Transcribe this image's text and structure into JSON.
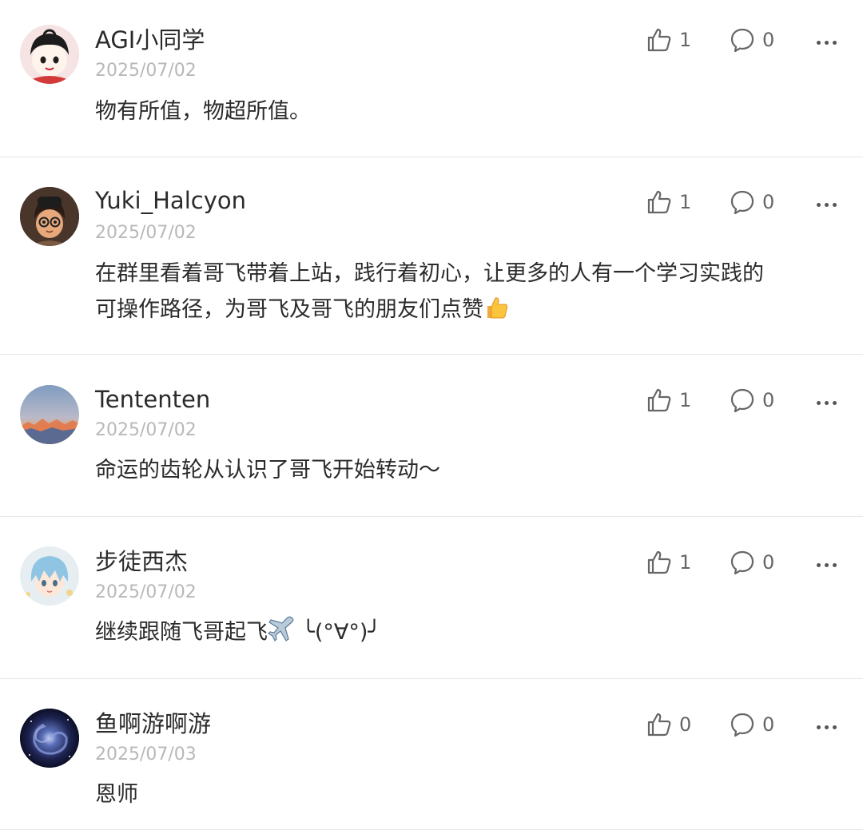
{
  "comments": [
    {
      "user": "AGI小同学",
      "date": "2025/07/02",
      "text": "物有所值，物超所值。",
      "likes": "1",
      "replies": "0"
    },
    {
      "user": "Yuki_Halcyon",
      "date": "2025/07/02",
      "text_line1": "在群里看着哥飞带着上站，践行着初心，让更多的人有一个学习实践的",
      "text_line2": "可操作路径，为哥飞及哥飞的朋友们点赞",
      "likes": "1",
      "replies": "0"
    },
    {
      "user": "Tententen",
      "date": "2025/07/02",
      "text": "命运的齿轮从认识了哥飞开始转动～",
      "likes": "1",
      "replies": "0"
    },
    {
      "user": "步徒西杰",
      "date": "2025/07/02",
      "text": "继续跟随飞哥起飞",
      "text_suffix": " ╰(°∀°)╯",
      "likes": "1",
      "replies": "0"
    },
    {
      "user": "鱼啊游啊游",
      "date": "2025/07/03",
      "text": "恩师",
      "likes": "0",
      "replies": "0"
    }
  ],
  "icons": {
    "like": "thumbs-up-outline-icon",
    "reply": "speech-bubble-outline-icon",
    "more": "ellipsis-icon",
    "emoji_thumb": "thumbs-up-emoji",
    "emoji_plane": "airplane-emoji"
  },
  "colors": {
    "text": "#2b2b2b",
    "date": "#b8b8b8",
    "icon": "#666666",
    "divider": "#e6e6e6"
  }
}
